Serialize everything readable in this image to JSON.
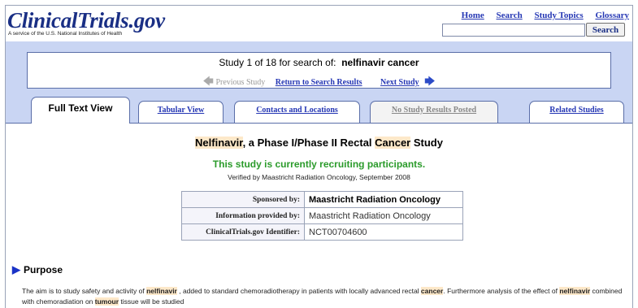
{
  "header": {
    "logo": "ClinicalTrials.gov",
    "tagline": "A service of the U.S. National Institutes of Health",
    "links": [
      "Home",
      "Search",
      "Study Topics",
      "Glossary"
    ],
    "search_button": "Search",
    "search_value": ""
  },
  "nav": {
    "study_of": "Study 1 of 18 for search of:",
    "query": "nelfinavir cancer",
    "previous": "Previous Study",
    "return": "Return to Search Results",
    "next": "Next Study"
  },
  "tabs": [
    {
      "label": "Full Text View",
      "state": "active"
    },
    {
      "label": "Tabular View",
      "state": "link"
    },
    {
      "label": "Contacts and Locations",
      "state": "link"
    },
    {
      "label": "No Study Results Posted",
      "state": "disabled"
    },
    {
      "label": "Related Studies",
      "state": "link"
    }
  ],
  "study": {
    "title_part1": "Nelfinavir",
    "title_part2": ", a Phase I/Phase II Rectal ",
    "title_part3": "Cancer",
    "title_part4": " Study",
    "status": "This study is currently recruiting participants.",
    "verified": "Verified by Maastricht Radiation Oncology, September 2008"
  },
  "info_table": [
    {
      "label": "Sponsored by:",
      "value": "Maastricht Radiation Oncology"
    },
    {
      "label": "Information provided by:",
      "value": "Maastricht Radiation Oncology"
    },
    {
      "label": "ClinicalTrials.gov Identifier:",
      "value": "NCT00704600"
    }
  ],
  "purpose": {
    "heading": "Purpose",
    "t1": "The aim is to study safety and activity of ",
    "t2": "nelfinavir",
    "t3": " , added to standard chemoradiotherapy in patients with locally advanced rectal ",
    "t4": "cancer",
    "t5": ". Furthermore analysis of the effect of ",
    "t6": "nelfinavir",
    "t7": " combined with chemoradiation on ",
    "t8": "tumour",
    "t9": " tissue will be studied"
  },
  "colors": {
    "brand": "#1a2f85",
    "link": "#2537b4",
    "band": "#c9d5f3",
    "recruiting": "#2b9b2b",
    "highlight": "#fde8c9"
  }
}
